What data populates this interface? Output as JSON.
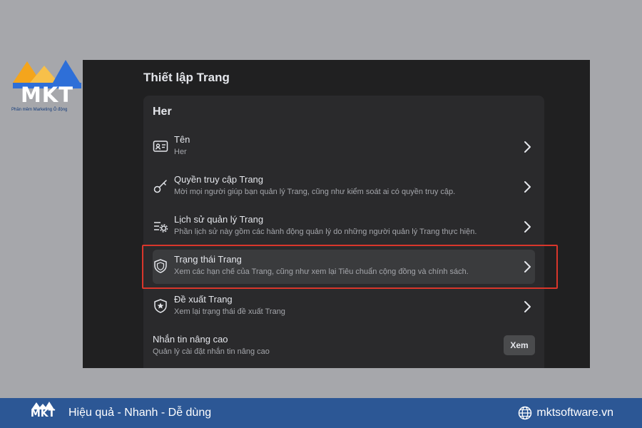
{
  "brand": {
    "logo_text": "MKT",
    "tagline": "Phần mềm Marketing Ô động",
    "colors": {
      "orange": "#f4a51c",
      "blue": "#2e6fd8",
      "banner": "#2c5795"
    }
  },
  "panel": {
    "title": "Thiết lập Trang",
    "card_title": "Her",
    "rows": [
      {
        "icon": "id-card-icon",
        "label": "Tên",
        "desc": "Her"
      },
      {
        "icon": "key-icon",
        "label": "Quyền truy cập Trang",
        "desc": "Mời mọi người giúp bạn quản lý Trang, cũng như kiểm soát ai có quyền truy cập."
      },
      {
        "icon": "settings-list-icon",
        "label": "Lịch sử quản lý Trang",
        "desc": "Phần lịch sử này gồm các hành động quản lý do những người quản lý Trang thực hiện."
      },
      {
        "icon": "shield-icon",
        "label": "Trạng thái Trang",
        "desc": "Xem các hạn chế của Trang, cũng như xem lại Tiêu chuẩn cộng đồng và chính sách."
      },
      {
        "icon": "star-shield-icon",
        "label": "Đề xuất Trang",
        "desc": "Xem lại trạng thái đề xuất Trang"
      },
      {
        "icon": "",
        "label": "Nhắn tin nâng cao",
        "desc": "Quản lý cài đặt nhắn tin nâng cao",
        "button": "Xem"
      }
    ]
  },
  "banner": {
    "logo_text": "MKT",
    "slogan": "Hiệu quả - Nhanh - Dễ dùng",
    "website": "mktsoftware.vn"
  }
}
